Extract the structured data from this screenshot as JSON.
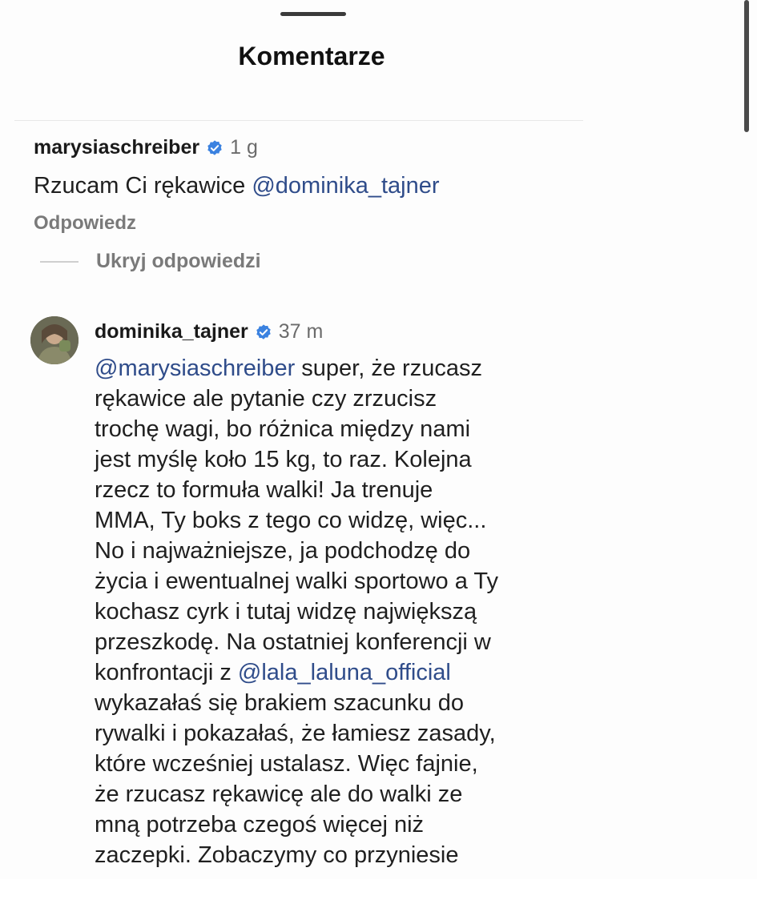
{
  "sheet": {
    "title": "Komentarze"
  },
  "comment1": {
    "username": "marysiaschreiber",
    "timestamp": "1 g",
    "text_plain": "Rzucam Ci rękawice ",
    "mention": "@dominika_tajner",
    "reply_label": "Odpowiedz"
  },
  "hide_replies_label": "Ukryj odpowiedzi",
  "comment2": {
    "username": "dominika_tajner",
    "timestamp": "37 m",
    "mention_start": "@marysiaschreiber",
    "line1_rest": " super, że rzucasz",
    "lines_a": [
      "rękawice ale pytanie czy zrzucisz",
      "trochę wagi, bo różnica między nami",
      "jest myślę koło 15 kg, to raz. Kolejna",
      "rzecz to formuła walki! Ja trenuje",
      "MMA, Ty boks z tego co widzę, więc...",
      "No i najważniejsze, ja podchodzę do",
      "życia i ewentualnej walki sportowo a Ty",
      "kochasz cyrk i tutaj widzę największą",
      "przeszkodę. Na ostatniej konferencji w"
    ],
    "line_mention_prefix": "konfrontacji z ",
    "mention_mid": "@lala_laluna_official",
    "lines_b": [
      "wykazałaś się brakiem szacunku do",
      "rywalki i pokazałaś, że łamiesz zasady,",
      "które wcześniej ustalasz. Więc fajnie,",
      "że rzucasz rękawicę ale do walki ze",
      "mną potrzeba czegoś więcej niż",
      "zaczepki. Zobaczymy co przyniesie"
    ]
  },
  "colors": {
    "mention": "#2f4c8a",
    "verified_badge": "#3b82e0",
    "secondary_text": "#7a7a7a"
  },
  "icons": {
    "verified": "verified-badge-icon",
    "avatar": "profile-photo"
  }
}
